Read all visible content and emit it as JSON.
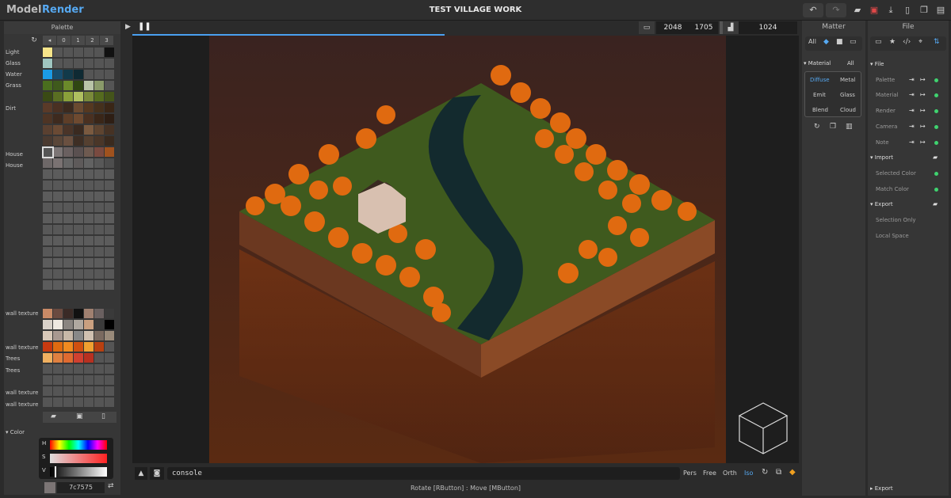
{
  "header": {
    "mode_model": "Model",
    "mode_render": "Render",
    "title": "TEST VILLAGE WORK",
    "accent": "#56a9f2"
  },
  "palette": {
    "title": "Palette",
    "tabs": [
      "◂",
      "0",
      "1",
      "2",
      "3"
    ],
    "labels": [
      "Light",
      "Glass",
      "Water",
      "Grass",
      "Dirt",
      "House",
      "House",
      "wall texture",
      "wall texture",
      "Trees",
      "Trees",
      "wall texture",
      "wall texture"
    ],
    "color_section": "Color",
    "picker_labels": [
      "H",
      "S",
      "V"
    ],
    "hex": "7c7575"
  },
  "render": {
    "width": "2048",
    "height": "1705",
    "samples": "1024",
    "console_placeholder": "console",
    "views": [
      "Pers",
      "Free",
      "Orth",
      "Iso"
    ],
    "active_view": "Iso",
    "status": "Rotate [RButton] : Move [MButton]"
  },
  "matter": {
    "title": "Matter",
    "filter_all": "All",
    "section": "Material",
    "section_all": "All",
    "materials": [
      "Diffuse",
      "Metal",
      "Emit",
      "Glass",
      "Blend",
      "Cloud"
    ],
    "active": "Diffuse"
  },
  "file": {
    "title": "File",
    "section_file": "File",
    "file_items": [
      "Palette",
      "Material",
      "Render",
      "Camera",
      "Note"
    ],
    "section_import": "Import",
    "import_items": [
      "Selected Color",
      "Match Color"
    ],
    "section_export": "Export",
    "export_items": [
      "Selection Only",
      "Local Space"
    ],
    "footer_export": "Export",
    "status_color": "#3fd36f"
  }
}
